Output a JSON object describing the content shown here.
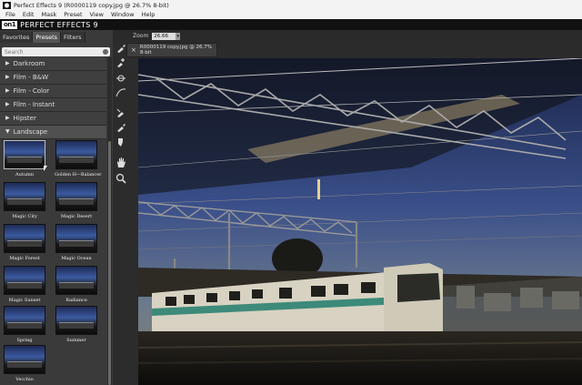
{
  "window": {
    "title": "Perfect Effects 9 (R0000119 copy.jpg @ 26.7% 8-bit)"
  },
  "menu": [
    "File",
    "Edit",
    "Mask",
    "Preset",
    "View",
    "Window",
    "Help"
  ],
  "brand": {
    "mark": "on1",
    "name": "PERFECT EFFECTS 9"
  },
  "panel": {
    "tabs": [
      "Favorites",
      "Presets",
      "Filters"
    ],
    "active_tab": "Presets",
    "search_placeholder": "Search",
    "categories": [
      {
        "label": "Darkroom",
        "open": false
      },
      {
        "label": "Film - B&W",
        "open": false
      },
      {
        "label": "Film - Color",
        "open": false
      },
      {
        "label": "Film - Instant",
        "open": false
      },
      {
        "label": "Hipster",
        "open": false
      },
      {
        "label": "Landscape",
        "open": true
      }
    ],
    "presets": [
      "Autumn",
      "Golden H—Balancer",
      "Magic City",
      "Magic Desert",
      "Magic Forest",
      "Magic Ocean",
      "Magic Sunset",
      "Radiance",
      "Spring",
      "Summer",
      "Vecchio"
    ],
    "selected_preset": "Autumn"
  },
  "zoom": {
    "label": "Zoom",
    "value": "26.66"
  },
  "document_tab": {
    "label": "R0000119 copy.jpg @ 26.7% 8-bit"
  },
  "tools": [
    "brush-icon",
    "brush-plus-icon",
    "mask-line-icon",
    "curve-icon",
    "brush-alt-icon",
    "brush-fill-icon",
    "chisel-icon",
    "hand-icon",
    "magnifier-icon"
  ],
  "colors": {
    "accent": "#3d8a7a",
    "panel": "#3a3a3a",
    "sky_top": "#1c2a55",
    "train_stripe": "#2e8a6e"
  }
}
